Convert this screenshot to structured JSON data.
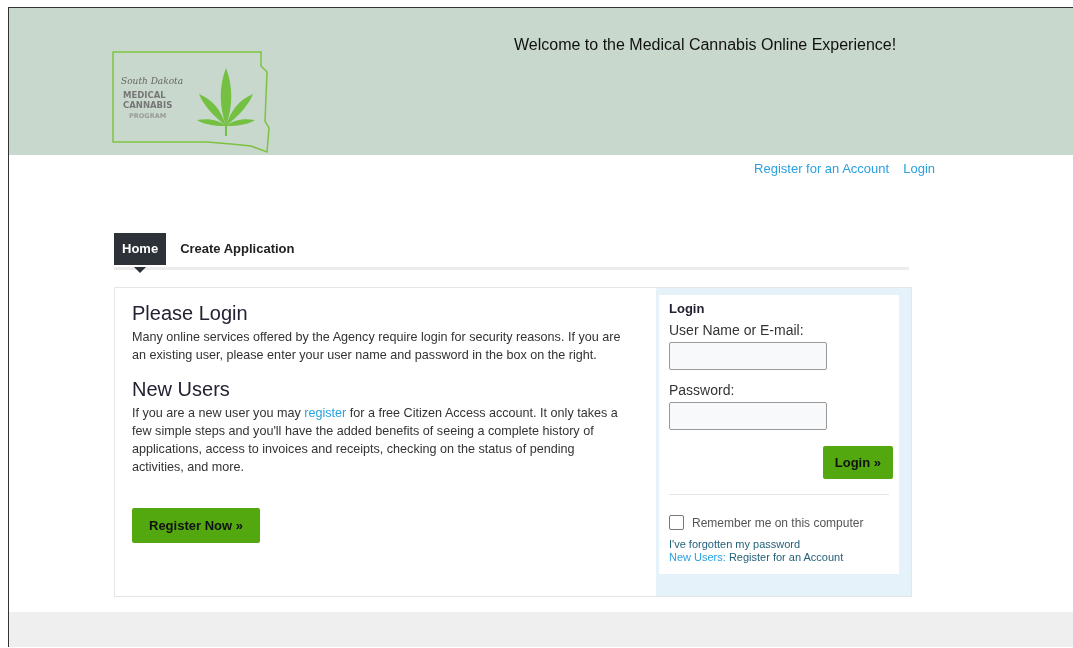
{
  "header": {
    "logo": {
      "script": "South Dakota",
      "lines": [
        "MEDICAL",
        "CANNABIS",
        "PROGRAM"
      ]
    },
    "welcome": "Welcome to the Medical Cannabis Online Experience!"
  },
  "top_links": [
    "Register for an Account",
    "Login"
  ],
  "tabs": [
    {
      "label": "Home",
      "selected": true
    },
    {
      "label": "Create Application",
      "selected": false
    }
  ],
  "intro": {
    "sections": [
      {
        "heading": "Please Login",
        "before": "Many online services offered by the Agency require login for security reasons. If you are an existing user, please enter your user name and password in the box on the right."
      },
      {
        "heading": "New Users",
        "before": "If you are a new user you may ",
        "link": "register",
        "after": " for a free Citizen Access account. It only takes a few simple steps and you'll have the added benefits of seeing a complete history of applications, access to invoices and receipts, checking on the status of pending activities, and more."
      }
    ],
    "button": "Register Now »"
  },
  "login_box": {
    "title": "Login",
    "fields": [
      {
        "label": "User Name or E-mail:"
      },
      {
        "label": "Password:"
      }
    ],
    "button": "Login »",
    "remember": {
      "label": "Remember me on this computer",
      "checked": false
    },
    "forgot": "I've forgotten my password",
    "new_users": {
      "prefix": "New Users:",
      "link": "Register for an Account"
    }
  }
}
